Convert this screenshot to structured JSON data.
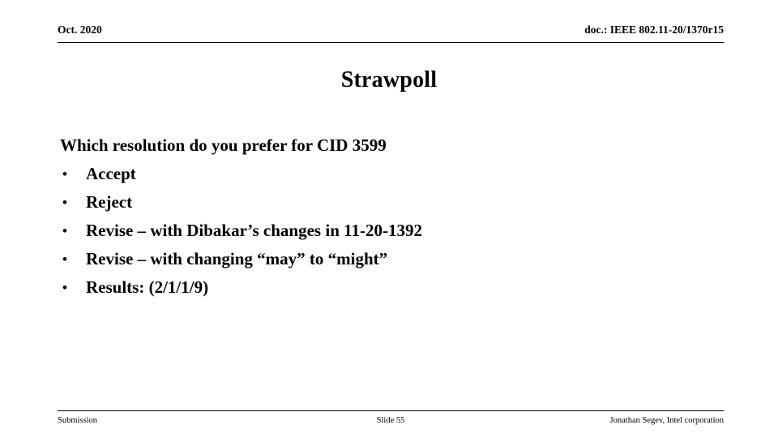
{
  "header": {
    "left": "Oct. 2020",
    "right": "doc.: IEEE 802.11-20/1370r15"
  },
  "title": "Strawpoll",
  "body": {
    "lead": "Which resolution do you prefer for CID 3599",
    "bullet_marker": "•",
    "bullets": [
      {
        "label": "Accept"
      },
      {
        "label": "Reject"
      },
      {
        "label": "Revise – with Dibakar’s changes in 11-20-1392"
      },
      {
        "label": "Revise – with changing “may” to “might”"
      },
      {
        "label": "Results: (2/1/1/9)"
      }
    ]
  },
  "footer": {
    "left": "Submission",
    "center": "Slide 55",
    "right": "Jonathan Segev, Intel corporation"
  },
  "colors": {
    "text": "#000000",
    "background": "#ffffff",
    "rule": "#000000"
  }
}
